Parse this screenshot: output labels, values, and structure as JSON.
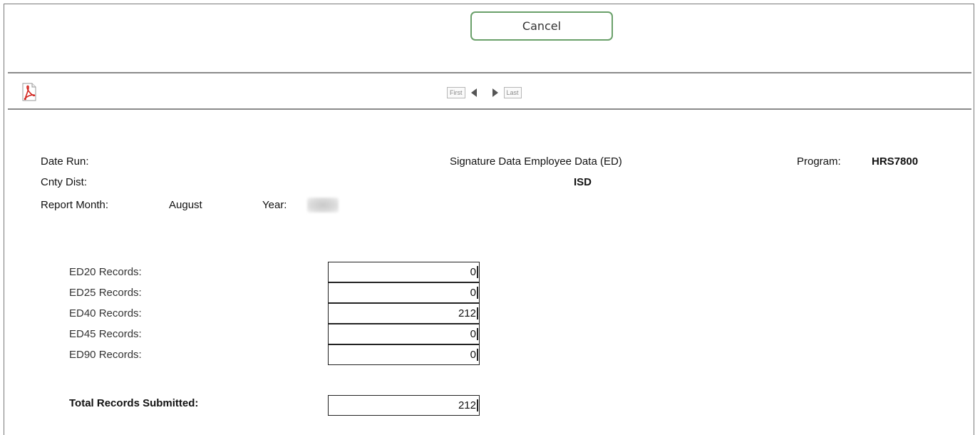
{
  "toolbar": {
    "cancel_label": "Cancel"
  },
  "pager": {
    "first_label": "First",
    "last_label": "Last"
  },
  "icons": {
    "export": "pdf-icon",
    "prev": "chevron-left-icon",
    "next": "chevron-right-icon"
  },
  "report_header": {
    "date_run_label": "Date Run:",
    "title": "Signature Data Employee Data (ED)",
    "program_label": "Program:",
    "program_value": "HRS7800",
    "cnty_dist_label": "Cnty Dist:",
    "district_value": "ISD",
    "report_month_label": "Report Month:",
    "report_month_value": "August",
    "year_label": "Year:"
  },
  "records": [
    {
      "label": "ED20 Records:",
      "value": "0"
    },
    {
      "label": "ED25 Records:",
      "value": "0"
    },
    {
      "label": "ED40 Records:",
      "value": "212"
    },
    {
      "label": "ED45 Records:",
      "value": "0"
    },
    {
      "label": "ED90 Records:",
      "value": "0"
    }
  ],
  "total": {
    "label": "Total Records Submitted:",
    "value": "212"
  },
  "colors": {
    "cancel_border": "#6aa06a",
    "pdf_red": "#d2231d",
    "rule": "#8a8a8a"
  }
}
